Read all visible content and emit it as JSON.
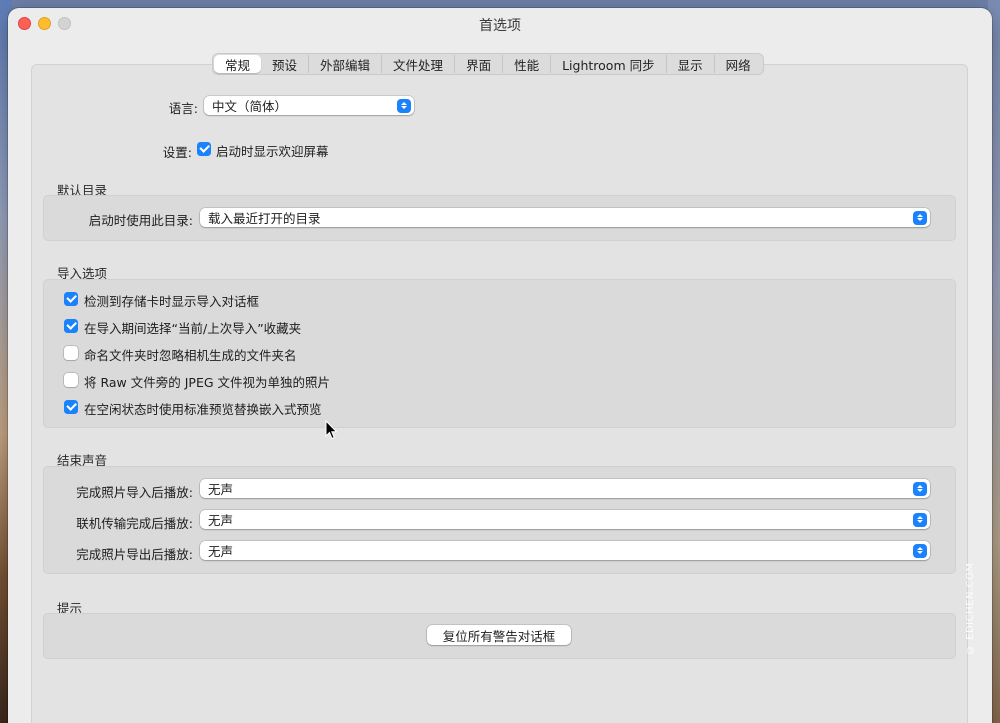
{
  "window": {
    "title": "首选项"
  },
  "tabs": [
    {
      "label": "常规",
      "active": true
    },
    {
      "label": "预设"
    },
    {
      "label": "外部编辑"
    },
    {
      "label": "文件处理"
    },
    {
      "label": "界面"
    },
    {
      "label": "性能"
    },
    {
      "label": "Lightroom 同步"
    },
    {
      "label": "显示"
    },
    {
      "label": "网络"
    }
  ],
  "general": {
    "language_label": "语言:",
    "language_value": "中文（简体）",
    "settings_label": "设置:",
    "show_splash_label": "启动时显示欢迎屏幕",
    "show_splash_checked": true
  },
  "default_catalog": {
    "title": "默认目录",
    "startup_label": "启动时使用此目录:",
    "startup_value": "载入最近打开的目录"
  },
  "import_options": {
    "title": "导入选项",
    "items": [
      {
        "label": "检测到存储卡时显示导入对话框",
        "checked": true
      },
      {
        "label": "在导入期间选择“当前/上次导入”收藏夹",
        "checked": true
      },
      {
        "label": "命名文件夹时忽略相机生成的文件夹名",
        "checked": false
      },
      {
        "label": "将 Raw 文件旁的 JPEG 文件视为单独的照片",
        "checked": false
      },
      {
        "label": "在空闲状态时使用标准预览替换嵌入式预览",
        "checked": true
      }
    ]
  },
  "completion_sounds": {
    "title": "结束声音",
    "rows": [
      {
        "label": "完成照片导入后播放:",
        "value": "无声"
      },
      {
        "label": "联机传输完成后播放:",
        "value": "无声"
      },
      {
        "label": "完成照片导出后播放:",
        "value": "无声"
      }
    ]
  },
  "prompts": {
    "title": "提示",
    "reset_button": "复位所有警告对话框"
  },
  "watermark": "© EDICHEN.COM",
  "colors": {
    "accent": "#1a82fb",
    "window_bg": "#ececec",
    "group_bg": "#dadada"
  }
}
